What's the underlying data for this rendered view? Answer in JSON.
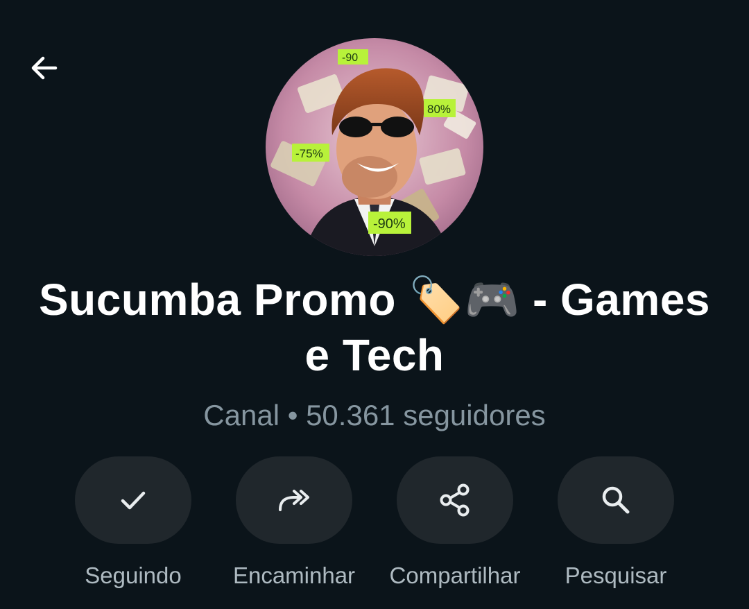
{
  "header": {
    "back_icon": "arrow-left-icon"
  },
  "channel": {
    "avatar_alt": "channel-avatar",
    "avatar_badges": [
      "-90",
      "80%",
      "-75%",
      "-90%"
    ],
    "name_line1": "Sucumba Promo 🏷️🎮  - Games",
    "name_line2": "e Tech",
    "meta": "Canal • 50.361 seguidores"
  },
  "actions": [
    {
      "id": "following",
      "label": "Seguindo",
      "icon": "check-icon"
    },
    {
      "id": "forward",
      "label": "Encaminhar",
      "icon": "forward-icon"
    },
    {
      "id": "share",
      "label": "Compartilhar",
      "icon": "share-icon"
    },
    {
      "id": "search",
      "label": "Pesquisar",
      "icon": "search-icon"
    }
  ],
  "colors": {
    "background": "#0b141a",
    "button_bg": "#20272c",
    "title": "#ffffff",
    "secondary_text": "#8696a0",
    "label_text": "#aebac1",
    "badge": "#b8f23a"
  }
}
